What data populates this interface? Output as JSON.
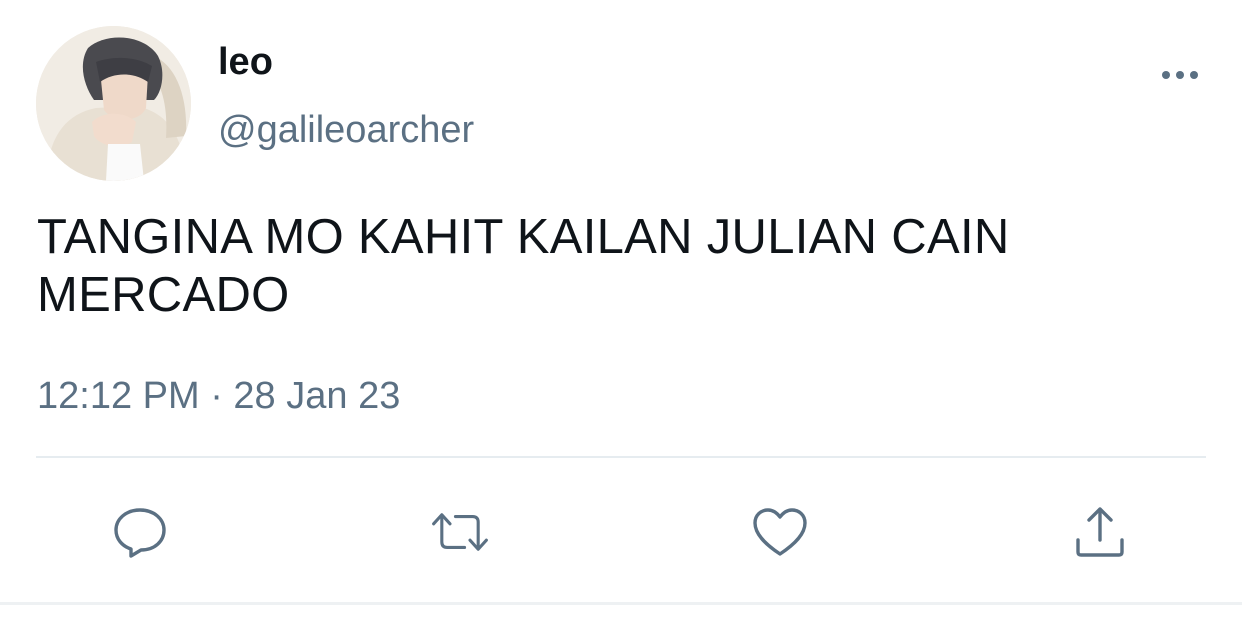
{
  "user": {
    "display_name": "leo",
    "handle": "@galileoarcher"
  },
  "tweet": {
    "text": "TANGINA MO KAHIT KAILAN JULIAN CAIN MERCADO",
    "timestamp": "12:12 PM · 28 Jan 23"
  },
  "actions": [
    {
      "name": "reply",
      "icon": "reply-icon"
    },
    {
      "name": "retweet",
      "icon": "retweet-icon"
    },
    {
      "name": "like",
      "icon": "heart-icon"
    },
    {
      "name": "share",
      "icon": "share-icon"
    }
  ],
  "colors": {
    "primary_text": "#0f1419",
    "secondary_text": "#5b7083",
    "icon": "#5b7083",
    "divider": "#e6ecf0"
  }
}
